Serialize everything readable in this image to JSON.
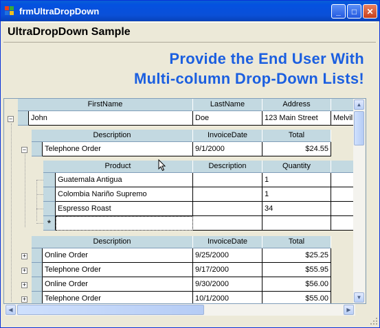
{
  "window": {
    "title": "frmUltraDropDown"
  },
  "header": {
    "title": "UltraDropDown Sample"
  },
  "promo": {
    "line1": "Provide the End User With",
    "line2": "Multi-column Drop-Down Lists!",
    "color": "#1b5fe0"
  },
  "customers": {
    "columns": [
      "FirstName",
      "LastName",
      "Address"
    ],
    "rows": [
      {
        "first": "John",
        "last": "Doe",
        "address": "123 Main Street",
        "extra": "Melvill"
      }
    ]
  },
  "orders_top": {
    "columns": [
      "Description",
      "InvoiceDate",
      "Total"
    ],
    "rows": [
      {
        "description": "Telephone Order",
        "date": "9/1/2000",
        "total": "$24.55"
      }
    ]
  },
  "products": {
    "columns": [
      "Product",
      "Description",
      "Quantity"
    ],
    "rows": [
      {
        "product": "Guatemala Antigua",
        "description": "",
        "quantity": "1"
      },
      {
        "product": "Colombia Nariño Supremo",
        "description": "",
        "quantity": "1"
      },
      {
        "product": "Espresso Roast",
        "description": "",
        "quantity": "34"
      }
    ],
    "new_row_marker": "*"
  },
  "orders_bottom": {
    "columns": [
      "Description",
      "InvoiceDate",
      "Total"
    ],
    "rows": [
      {
        "description": "Online Order",
        "date": "9/25/2000",
        "total": "$25.25"
      },
      {
        "description": "Telephone Order",
        "date": "9/17/2000",
        "total": "$55.95"
      },
      {
        "description": "Online Order",
        "date": "9/30/2000",
        "total": "$56.00"
      },
      {
        "description": "Telephone Order",
        "date": "10/1/2000",
        "total": "$55.00"
      }
    ]
  },
  "icons": {
    "expand": "plus-icon",
    "collapse": "minus-icon"
  }
}
